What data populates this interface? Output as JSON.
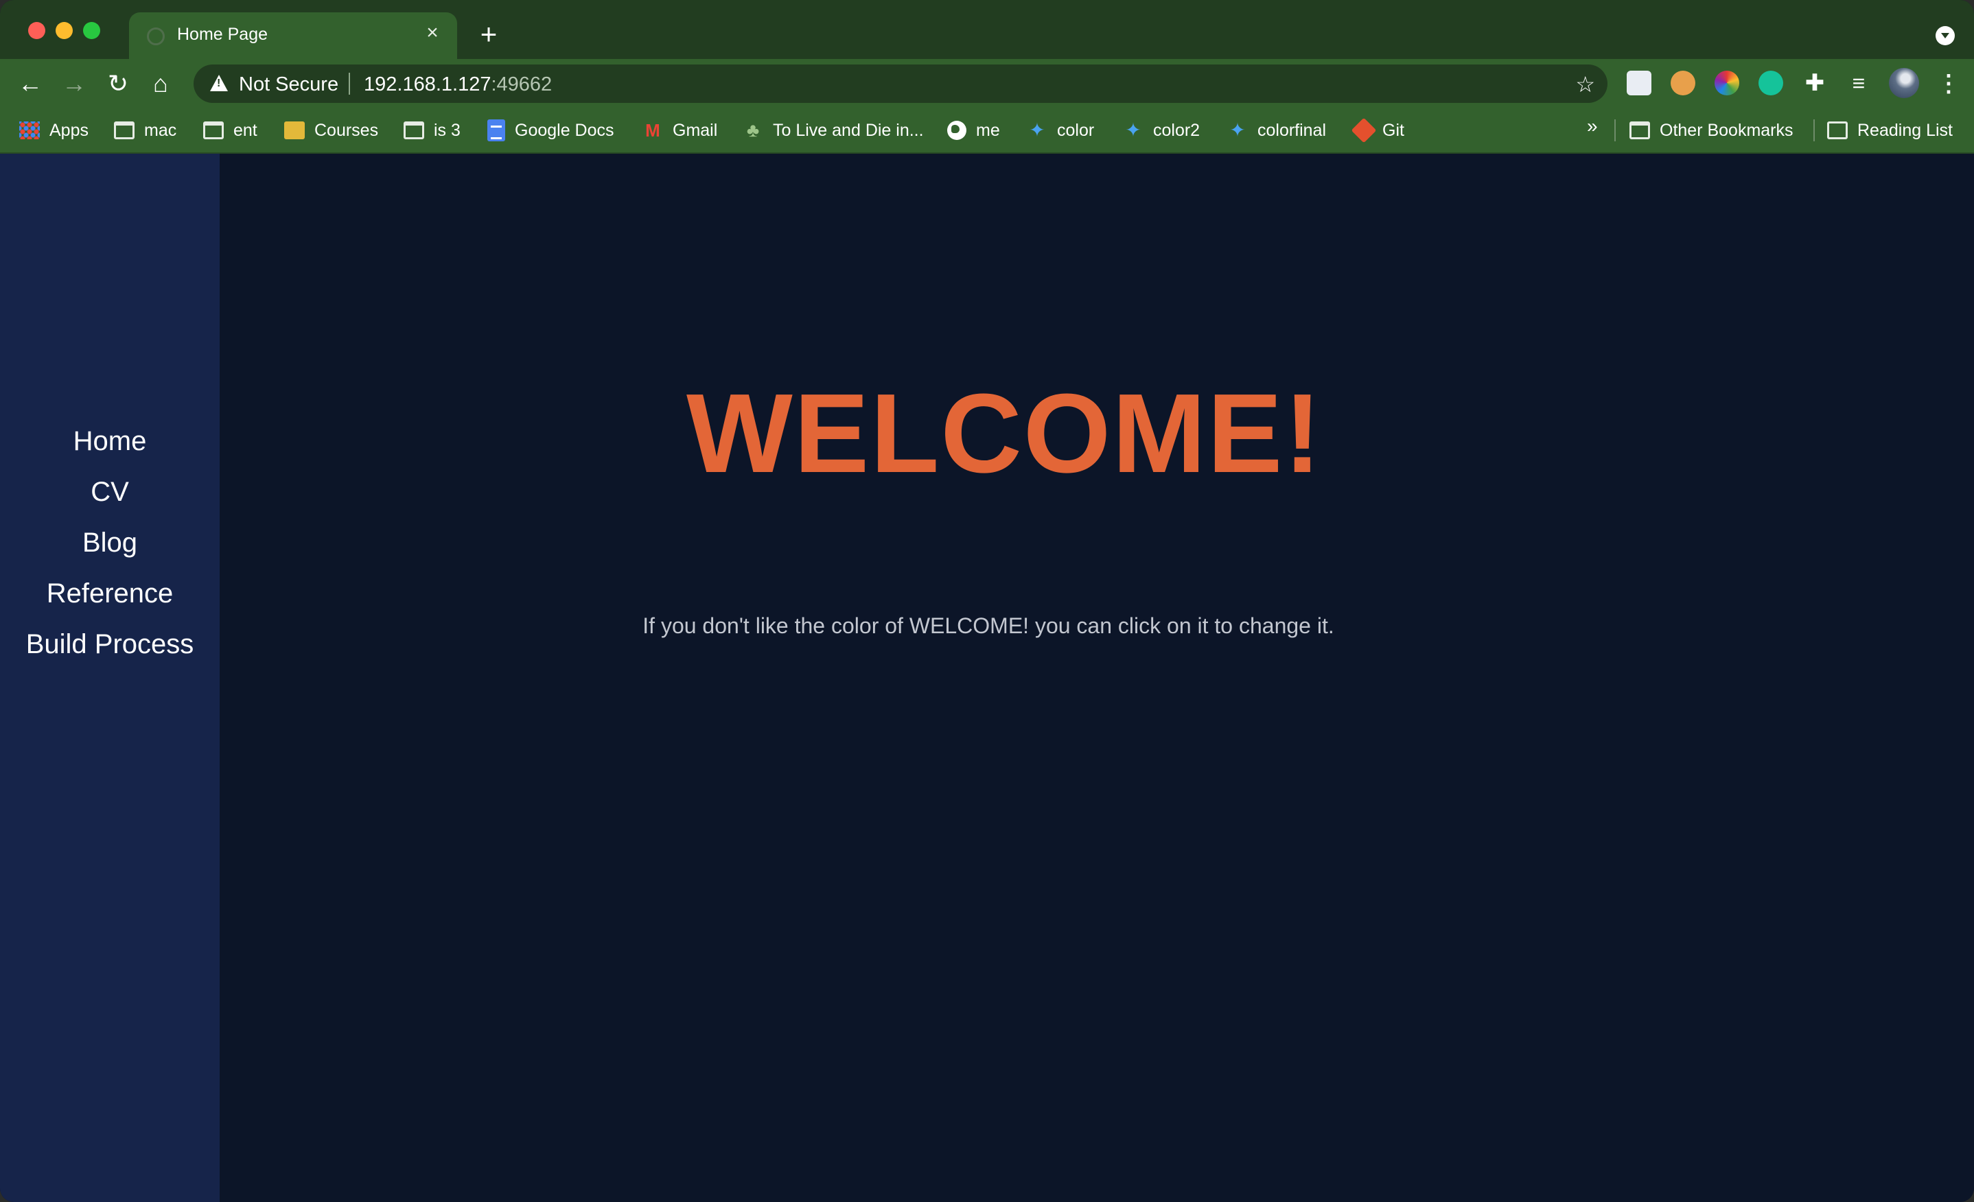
{
  "browser": {
    "tab": {
      "title": "Home Page"
    },
    "toolbar": {
      "security_label": "Not Secure",
      "url_host": "192.168.1.127",
      "url_port": ":49662"
    },
    "bookmarks": [
      {
        "label": "Apps",
        "icon": "apps-icon"
      },
      {
        "label": "mac",
        "icon": "folder-icon"
      },
      {
        "label": "ent",
        "icon": "folder-icon"
      },
      {
        "label": "Courses",
        "icon": "courses-icon"
      },
      {
        "label": "is 3",
        "icon": "folder-icon"
      },
      {
        "label": "Google Docs",
        "icon": "google-docs-icon"
      },
      {
        "label": "Gmail",
        "icon": "gmail-icon"
      },
      {
        "label": "To Live and Die in...",
        "icon": "plant-icon"
      },
      {
        "label": "me",
        "icon": "globe-icon"
      },
      {
        "label": "color",
        "icon": "twitter-icon"
      },
      {
        "label": "color2",
        "icon": "twitter-icon"
      },
      {
        "label": "colorfinal",
        "icon": "twitter-icon"
      },
      {
        "label": "Git",
        "icon": "git-icon"
      }
    ],
    "more_bookmarks": "»",
    "other_bookmarks": "Other Bookmarks",
    "reading_list": "Reading List"
  },
  "sidebar": {
    "items": [
      {
        "label": "Home"
      },
      {
        "label": "CV"
      },
      {
        "label": "Blog"
      },
      {
        "label": "Reference"
      },
      {
        "label": "Build Process"
      }
    ]
  },
  "main": {
    "heading": "WELCOME!",
    "hint": "If you don't like the color of WELCOME! you can click on it to change it."
  },
  "colors": {
    "heading": "#e36637",
    "sidebar_bg": "#16244a",
    "page_bg": "#0c1528",
    "browser_frame": "#33612d"
  }
}
